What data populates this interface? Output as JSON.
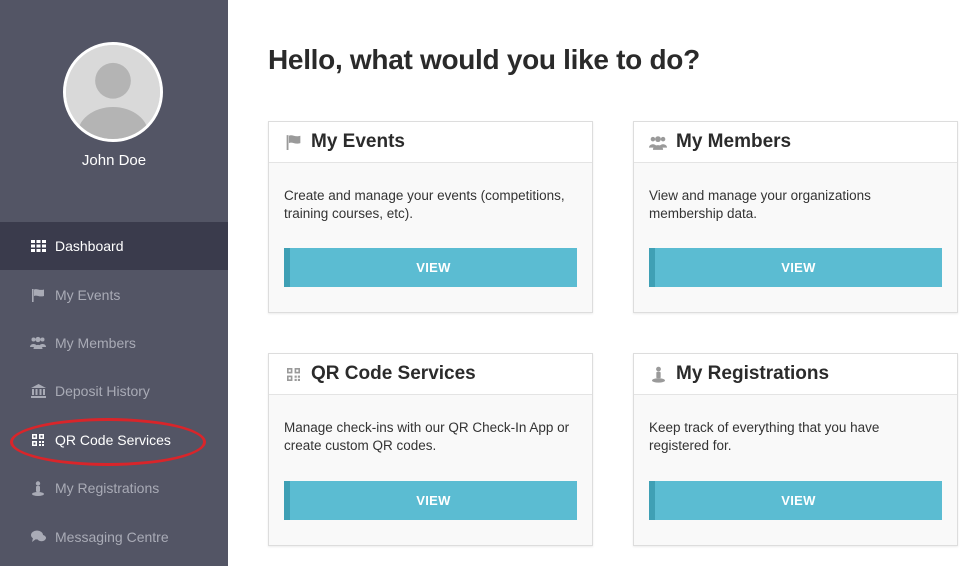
{
  "sidebar": {
    "user_name": "John Doe",
    "items": [
      {
        "label": "Dashboard",
        "icon": "grid-icon"
      },
      {
        "label": "My Events",
        "icon": "flag-icon"
      },
      {
        "label": "My Members",
        "icon": "users-icon"
      },
      {
        "label": "Deposit History",
        "icon": "bank-icon"
      },
      {
        "label": "QR Code Services",
        "icon": "qr-code-icon"
      },
      {
        "label": "My Registrations",
        "icon": "person-pin-icon"
      },
      {
        "label": "Messaging Centre",
        "icon": "chat-icon"
      }
    ]
  },
  "main": {
    "title": "Hello, what would you like to do?",
    "cards": [
      {
        "title": "My Events",
        "description": "Create and manage your events (competitions, training courses, etc).",
        "button": "VIEW",
        "icon": "flag-icon"
      },
      {
        "title": "My Members",
        "description": "View and manage your organizations membership data.",
        "button": "VIEW",
        "icon": "users-icon"
      },
      {
        "title": "QR Code Services",
        "description": "Manage check-ins with our QR Check-In App or create custom QR codes.",
        "button": "VIEW",
        "icon": "qr-code-icon"
      },
      {
        "title": "My Registrations",
        "description": "Keep track of everything that you have registered for.",
        "button": "VIEW",
        "icon": "person-pin-icon"
      }
    ]
  },
  "colors": {
    "sidebar_bg": "#535565",
    "sidebar_active_bg": "#3a3b4c",
    "button_bg": "#5bbcd2",
    "button_accent": "#3fa0b5",
    "annotation": "#d9252a"
  }
}
